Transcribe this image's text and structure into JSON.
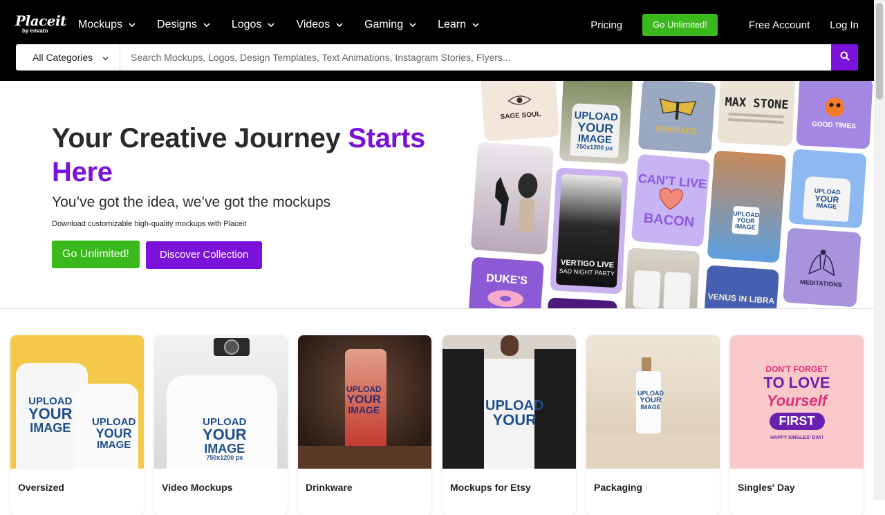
{
  "logo": {
    "name": "Placeit",
    "sub": "by envato"
  },
  "nav": {
    "items": [
      {
        "label": "Mockups"
      },
      {
        "label": "Designs"
      },
      {
        "label": "Logos"
      },
      {
        "label": "Videos"
      },
      {
        "label": "Gaming"
      },
      {
        "label": "Learn"
      }
    ],
    "pricing": "Pricing",
    "go_unlimited": "Go Unlimited!",
    "free_account": "Free Account",
    "login": "Log In"
  },
  "search": {
    "category": "All Categories",
    "placeholder": "Search Mockups, Logos, Design Templates, Text Animations, Instagram Stories, Flyers..."
  },
  "hero": {
    "title_main": "Your Creative Journey ",
    "title_accent": "Starts Here",
    "subtitle": "You’ve got the idea, we’ve got the mockups",
    "description": "Download customizable high-quality mockups with Placeit",
    "cta_primary": "Go Unlimited!",
    "cta_secondary": "Discover Collection"
  },
  "collage": {
    "sage_soul": "SAGE SOUL",
    "sphinxes": "SPHINXES",
    "max_stone": "MAX STONE",
    "good_times": "GOOD TIMES",
    "cant_live": "CAN'T LIVE",
    "bacon": "BACON",
    "vertigo": "VERTIGO LIVE",
    "sad_night": "SAD NIGHT PARTY",
    "dukes": "DUKE'S",
    "venus": "VENUS IN LIBRA",
    "meditations": "MEDITATIONS",
    "upload": "UPLOAD",
    "your": "YOUR",
    "image": "IMAGE",
    "size": "750x1200 px"
  },
  "categories": [
    {
      "label": "Oversized",
      "bg": "#f4c94a"
    },
    {
      "label": "Video Mockups",
      "bg": "#e9e9e9"
    },
    {
      "label": "Drinkware",
      "bg": "#3b2a22"
    },
    {
      "label": "Mockups for Etsy",
      "bg": "#d8d2ca"
    },
    {
      "label": "Packaging",
      "bg": "#e8dccb"
    },
    {
      "label": "Singles' Day",
      "bg": "#f9c8c8"
    }
  ],
  "singles": {
    "dont_forget": "DON'T FORGET",
    "to_love": "TO LOVE",
    "yourself": "Yourself",
    "first": "FIRST",
    "happy": "HAPPY SINGLES' DAY!"
  },
  "colors": {
    "accent_purple": "#7b12d9",
    "accent_green": "#39b91b",
    "topbar": "#000000"
  }
}
